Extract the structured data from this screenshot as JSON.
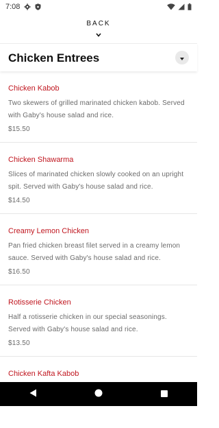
{
  "status_bar": {
    "time": "7:08",
    "icons": [
      "gear-icon",
      "shield-icon",
      "wifi-icon",
      "signal-icon",
      "battery-icon"
    ]
  },
  "header": {
    "back_label": "BACK",
    "back_icon": "chevron-down-icon"
  },
  "section": {
    "title": "Chicken Entrees",
    "toggle_icon": "caret-down-icon"
  },
  "colors": {
    "accent": "#c0161f",
    "text_muted": "#6a6a6a"
  },
  "items": [
    {
      "name": "Chicken Kabob",
      "description": "Two skewers of grilled marinated chicken kabob. Served with Gaby's house salad and rice.",
      "price": "$15.50"
    },
    {
      "name": "Chicken Shawarma",
      "description": "Slices of marinated chicken slowly cooked on an upright spit. Served with Gaby's house salad and rice.",
      "price": "$14.50"
    },
    {
      "name": "Creamy Lemon Chicken",
      "description": "Pan fried chicken breast filet served in a creamy lemon sauce. Served with Gaby's house salad and rice.",
      "price": "$16.50"
    },
    {
      "name": "Rotisserie Chicken",
      "description": "Half a rotisserie chicken in our special seasonings. Served with Gaby's house salad and rice.",
      "price": "$13.50"
    },
    {
      "name": "Chicken Kafta Kabob",
      "description": "",
      "price": ""
    }
  ],
  "nav": {
    "back_icon": "triangle-back-icon",
    "home_icon": "circle-home-icon",
    "recents_icon": "square-recents-icon"
  }
}
